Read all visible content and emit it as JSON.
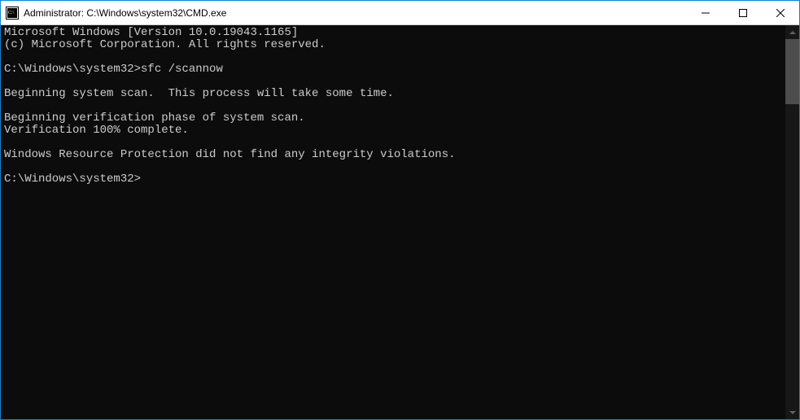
{
  "titlebar": {
    "title": "Administrator: C:\\Windows\\system32\\CMD.exe"
  },
  "console": {
    "line1": "Microsoft Windows [Version 10.0.19043.1165]",
    "line2": "(c) Microsoft Corporation. All rights reserved.",
    "prompt1_path": "C:\\Windows\\system32>",
    "prompt1_cmd": "sfc /scannow",
    "line3": "Beginning system scan.  This process will take some time.",
    "line4": "Beginning verification phase of system scan.",
    "line5": "Verification 100% complete.",
    "line6": "Windows Resource Protection did not find any integrity violations.",
    "prompt2_path": "C:\\Windows\\system32>"
  }
}
